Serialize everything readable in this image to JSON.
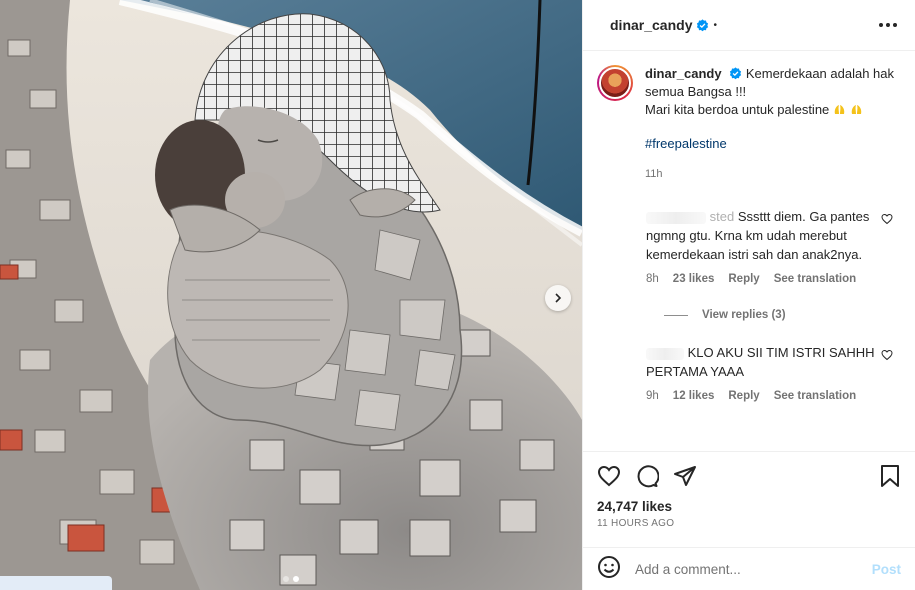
{
  "post": {
    "username": "dinar_candy",
    "separator": "•",
    "caption_line1": "Kemerdekaan adalah hak semua Bangsa !!!",
    "caption_line2": "Mari kita berdoa untuk palestine",
    "hashtag": "#freepalestine",
    "caption_time": "11h",
    "likes": "24,747 likes",
    "posted_ago": "11 HOURS AGO"
  },
  "comments": [
    {
      "user_visible": "sted",
      "text": "Sssttt diem. Ga pantes ngmng gtu. Krna km udah merebut kemerdekaan istri sah dan anak2nya.",
      "time": "8h",
      "likes": "23 likes",
      "reply": "Reply",
      "translate": "See translation",
      "view_replies": "View replies (3)"
    },
    {
      "user_visible": "",
      "text": "KLO AKU SII TIM ISTRI SAHHH PERTAMA YAAA",
      "time": "9h",
      "likes": "12 likes",
      "reply": "Reply",
      "translate": "See translation"
    }
  ],
  "composer": {
    "placeholder": "Add a comment...",
    "post_label": "Post"
  },
  "icons": {
    "verified": "verified-badge-icon",
    "more": "more-options-icon",
    "like": "heart-icon",
    "comment": "comment-icon",
    "share": "share-icon",
    "save": "bookmark-icon",
    "emoji": "emoji-icon",
    "next": "chevron-right-icon"
  },
  "colors": {
    "verified": "#0095f6",
    "hashtag": "#00376b",
    "post_disabled": "#b2dffc",
    "muted": "#737373"
  },
  "carousel": {
    "slide_count": 2,
    "active_slide": 2
  }
}
